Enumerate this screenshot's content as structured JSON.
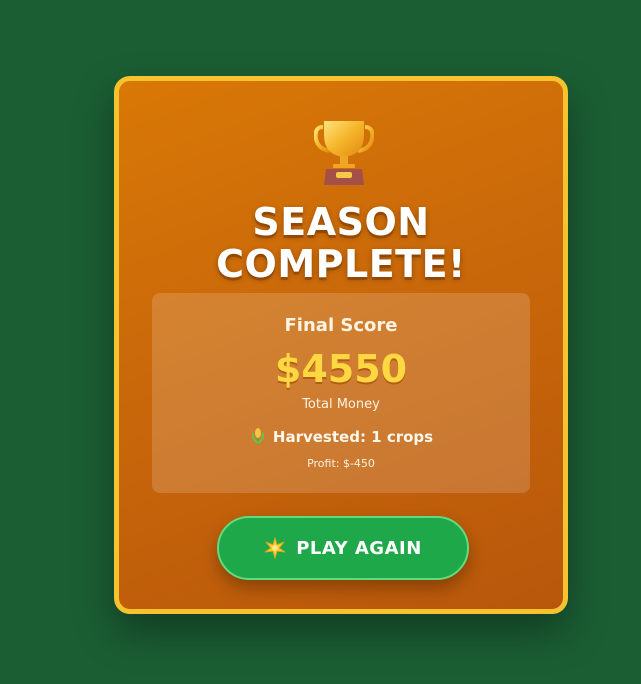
{
  "modal": {
    "title_line1": "SEASON",
    "title_line2": "COMPLETE!",
    "trophy_icon": "trophy-icon",
    "score_panel": {
      "label": "Final Score",
      "money": "$4550",
      "money_caption": "Total Money",
      "harvest_icon": "corn-icon",
      "harvested_text": "Harvested: 1 crops",
      "profit_text": "Profit: $-450"
    },
    "play_again": {
      "icon": "sparkle-icon",
      "label": "PLAY AGAIN"
    }
  },
  "colors": {
    "background": "#1b5e34",
    "card": "#d97806",
    "card_border": "#f6c22e",
    "money": "#ffd740",
    "button": "#1fa84a"
  }
}
